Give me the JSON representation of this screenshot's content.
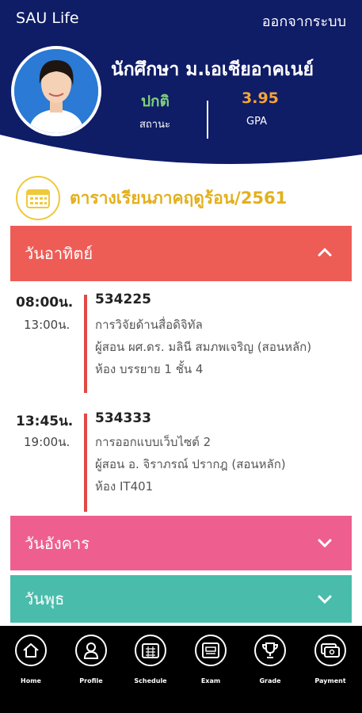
{
  "header": {
    "app_title": "SAU Life",
    "logout_label": "ออกจากระบบ",
    "student_name": "นักศึกษา ม.เอเชียอาคเนย์",
    "status_value": "ปกติ",
    "status_label": "สถานะ",
    "gpa_value": "3.95",
    "gpa_label": "GPA"
  },
  "schedule": {
    "title": "ตารางเรียนภาคฤดูร้อน/2561",
    "icon": "calendar-icon"
  },
  "days": [
    {
      "label": "วันอาทิตย์",
      "expanded": true,
      "color": "#ee5c56"
    },
    {
      "label": "วันอังคาร",
      "expanded": false,
      "color": "#ee5f8f"
    },
    {
      "label": "วันพุธ",
      "expanded": false,
      "color": "#49bcab"
    }
  ],
  "classes": [
    {
      "start": "08:00น.",
      "end": "13:00น.",
      "code": "534225",
      "name": "การวิจัยด้านสื่อดิจิทัล",
      "instructor": "ผู้สอน ผศ.ดร. มลินี สมภพเจริญ (สอนหลัก)",
      "room": "ห้อง บรรยาย 1 ชั้น 4"
    },
    {
      "start": "13:45น.",
      "end": "19:00น.",
      "code": "534333",
      "name": "การออกแบบเว็บไซต์ 2",
      "instructor": "ผู้สอน อ. จิราภรณ์ ปรากฎ (สอนหลัก)",
      "room": "ห้อง IT401"
    }
  ],
  "nav": [
    {
      "label": "Home",
      "icon": "home-icon"
    },
    {
      "label": "Profile",
      "icon": "profile-icon"
    },
    {
      "label": "Schedule",
      "icon": "schedule-icon"
    },
    {
      "label": "Exam",
      "icon": "exam-icon"
    },
    {
      "label": "Grade",
      "icon": "trophy-icon"
    },
    {
      "label": "Payment",
      "icon": "payment-icon"
    }
  ],
  "colors": {
    "header_bg": "#0f1c66",
    "accent_gold": "#e2b01c",
    "status_green": "#7fd17a",
    "gpa_orange": "#f4a43a"
  }
}
